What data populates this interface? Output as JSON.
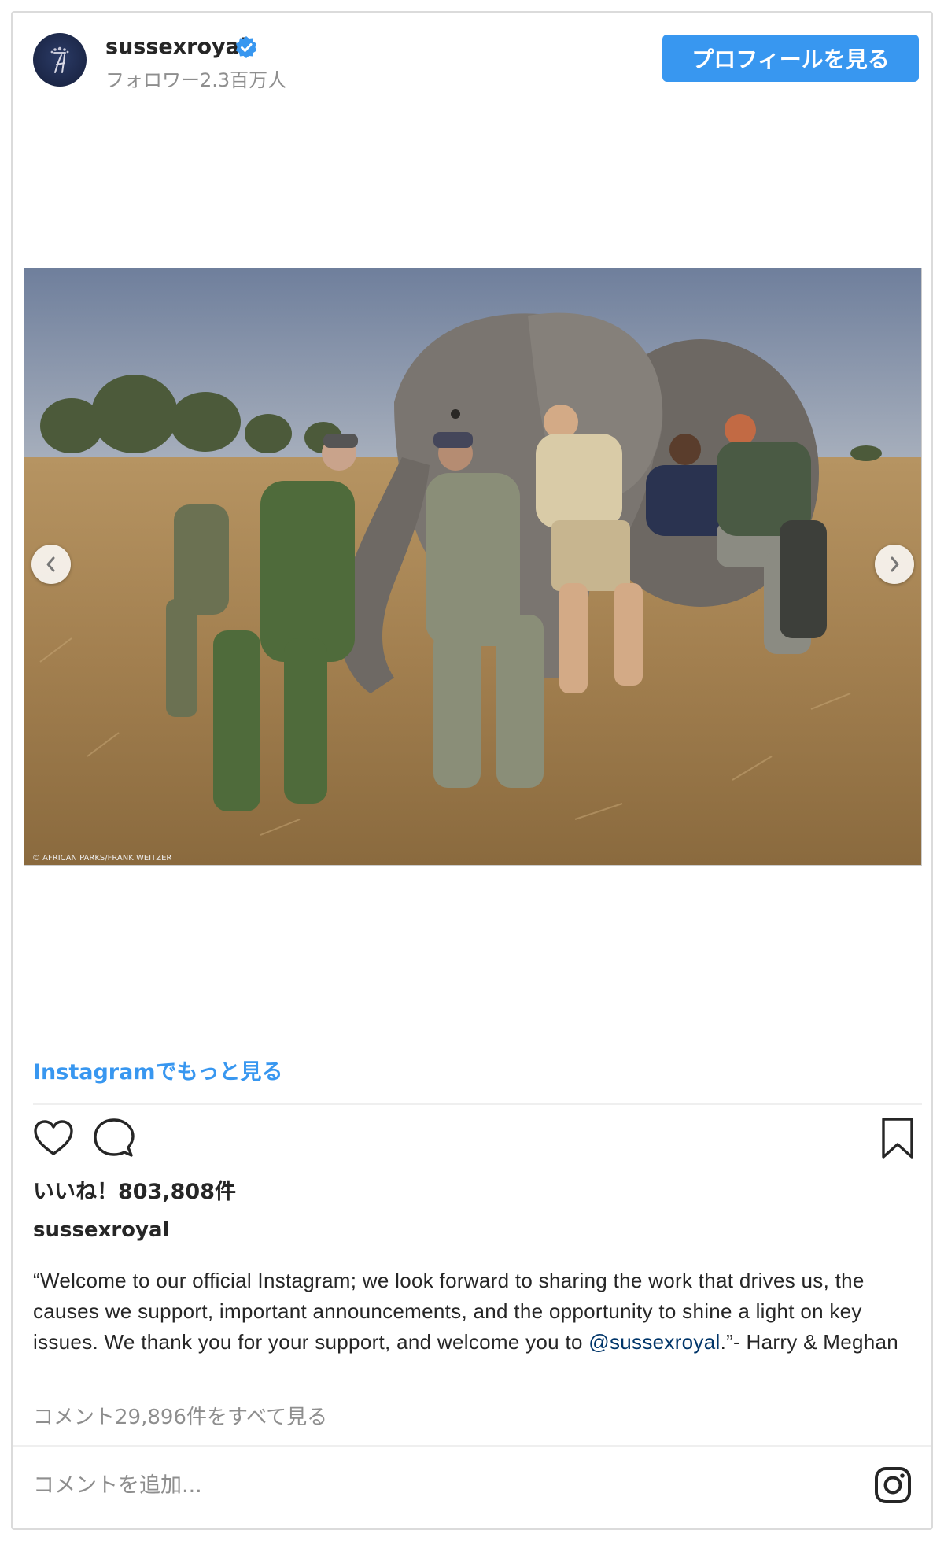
{
  "header": {
    "username": "sussexroyal",
    "followers": "フォロワー2.3百万人",
    "profile_button": "プロフィールを見る"
  },
  "photo": {
    "watermark": "© AFRICAN PARKS/FRANK WEITZER",
    "alt": "Men pushing a sedated elephant in dry grassland"
  },
  "see_more": "Instagramでもっと見る",
  "actions": {
    "icons": [
      "heart-icon",
      "comment-icon",
      "bookmark-icon"
    ]
  },
  "likes": "いいね！803,808件",
  "caption": {
    "username": "sussexroyal",
    "text_part1": "“Welcome to our official Instagram; we look forward to sharing the work that drives us, the causes we support, important announcements, and the opportunity to shine a light on key issues. We thank you for your support, and welcome you to ",
    "mention": "@sussexroyal",
    "text_part2": ".”- Harry & Meghan"
  },
  "view_comments": "コメント29,896件をすべて見る",
  "comment_input": {
    "placeholder": "コメントを追加..."
  },
  "colors": {
    "accent": "#3897f0",
    "verified": "#3897f0",
    "mention": "#003569"
  }
}
